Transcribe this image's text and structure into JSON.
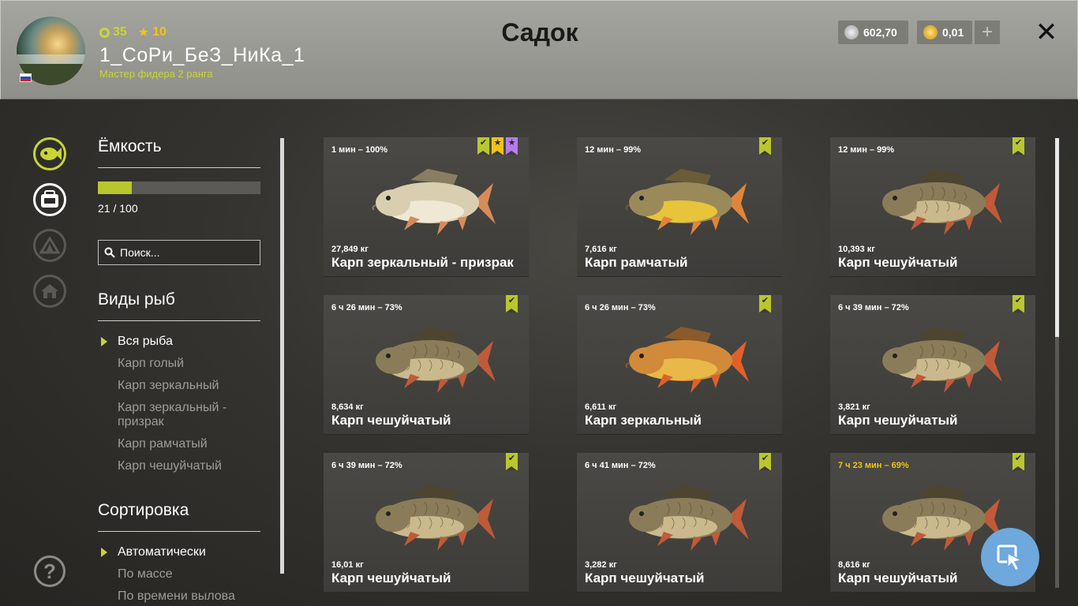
{
  "header": {
    "level": "35",
    "stars": "10",
    "username": "1_СоРи_БеЗ_НиКа_1",
    "user_title": "Мастер фидера 2 ранга",
    "page_title": "Садок",
    "silver": "602,70",
    "gold": "0,01",
    "add_label": "+",
    "close_label": "✕",
    "flag_colors": [
      "#ffffff",
      "#1f4fb5",
      "#d0202a"
    ]
  },
  "sidebar": {
    "capacity_title": "Ёмкость",
    "capacity_text": "21 / 100",
    "capacity_fraction": 0.21,
    "search_placeholder": "Поиск...",
    "species_title": "Виды рыб",
    "species": [
      {
        "label": "Вся рыба",
        "selected": true
      },
      {
        "label": "Карп голый",
        "selected": false
      },
      {
        "label": "Карп зеркальный",
        "selected": false
      },
      {
        "label": "Карп зеркальный - призрак",
        "selected": false
      },
      {
        "label": "Карп рамчатый",
        "selected": false
      },
      {
        "label": "Карп чешуйчатый",
        "selected": false
      }
    ],
    "sort_title": "Сортировка",
    "sort": [
      {
        "label": "Автоматически",
        "selected": true
      },
      {
        "label": "По массе",
        "selected": false
      },
      {
        "label": "По времени вылова",
        "selected": false
      }
    ],
    "help_label": "?"
  },
  "rail_icons": [
    "fish-icon",
    "cooler-icon",
    "tent-icon",
    "home-icon"
  ],
  "fish": [
    {
      "time": "1 мин – 100%",
      "weight": "27,849 кг",
      "name": "Карп зеркальный - призрак",
      "kind": "ghost",
      "badges": [
        "green",
        "gold",
        "purple"
      ],
      "warn": false
    },
    {
      "time": "12 мин – 99%",
      "weight": "7,616 кг",
      "name": "Карп рамчатый",
      "kind": "frame",
      "badges": [
        "green"
      ],
      "warn": false
    },
    {
      "time": "12 мин – 99%",
      "weight": "10,393 кг",
      "name": "Карп чешуйчатый",
      "kind": "scaled",
      "badges": [
        "green"
      ],
      "warn": false
    },
    {
      "time": "6 ч 26 мин – 73%",
      "weight": "8,634 кг",
      "name": "Карп чешуйчатый",
      "kind": "scaled",
      "badges": [
        "green"
      ],
      "warn": false
    },
    {
      "time": "6 ч 26 мин – 73%",
      "weight": "6,611 кг",
      "name": "Карп зеркальный",
      "kind": "mirror",
      "badges": [
        "green"
      ],
      "warn": false
    },
    {
      "time": "6 ч 39 мин – 72%",
      "weight": "3,821 кг",
      "name": "Карп чешуйчатый",
      "kind": "scaled",
      "badges": [
        "green"
      ],
      "warn": false
    },
    {
      "time": "6 ч 39 мин – 72%",
      "weight": "16,01 кг",
      "name": "Карп чешуйчатый",
      "kind": "scaled",
      "badges": [
        "green"
      ],
      "warn": false
    },
    {
      "time": "6 ч 41 мин – 72%",
      "weight": "3,282 кг",
      "name": "Карп чешуйчатый",
      "kind": "scaled",
      "badges": [
        "green"
      ],
      "warn": false
    },
    {
      "time": "7 ч 23 мин – 69%",
      "weight": "8,616 кг",
      "name": "Карп чешуйчатый",
      "kind": "scaled",
      "badges": [
        "green"
      ],
      "warn": true
    }
  ],
  "colors": {
    "accent": "#c8d535",
    "gold": "#f0c419",
    "fab": "#6ea8dc"
  }
}
